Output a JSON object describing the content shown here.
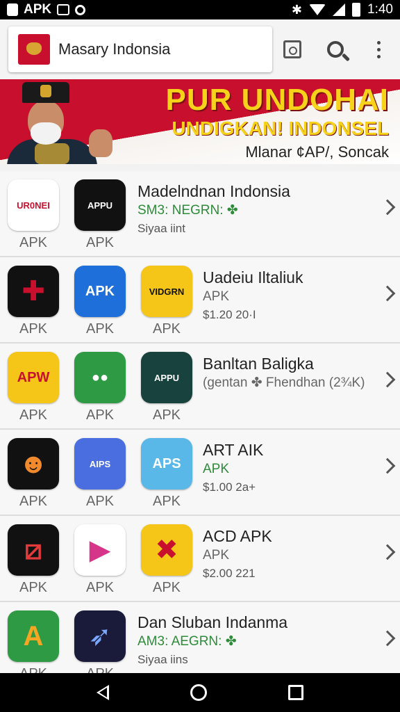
{
  "status_bar": {
    "left_label": "APK",
    "time": "1:40",
    "icons": [
      "android-icon",
      "apk-notify-icon",
      "sync-circle-icon",
      "bluetooth-icon",
      "wifi-icon",
      "signal-icon",
      "battery-icon"
    ]
  },
  "app_bar": {
    "search_title": "Masary Indonsia",
    "actions": [
      "calendar-icon",
      "search-icon",
      "more-vert-icon"
    ]
  },
  "banner": {
    "line1": "PUR UNDOHAI",
    "line2": "UNDIGKAN! INDONSEL",
    "line3": "Mlanar ¢AP/, Soncak"
  },
  "rows": [
    {
      "tiles": [
        {
          "glyph": "UR0NEI",
          "bg": "#ffffff",
          "fg": "#c8102e",
          "caption": "APK",
          "icon_name": "red-arrow-app-icon"
        },
        {
          "glyph": "APPU",
          "bg": "#111111",
          "fg": "#ffffff",
          "caption": "APK",
          "icon_name": "axe-app-icon"
        }
      ],
      "title": "Madelndnan Indonsia",
      "line2": "SM3: NEGRN: ✤",
      "line2_color": "green",
      "line3": "Siyaa iint"
    },
    {
      "tiles": [
        {
          "glyph": "✚",
          "bg": "#111111",
          "fg": "#c8102e",
          "caption": "APK",
          "icon_name": "compass-app-icon"
        },
        {
          "glyph": "APK",
          "bg": "#1e6fd9",
          "fg": "#ffffff",
          "caption": "APK",
          "icon_name": "blue-a-app-icon"
        },
        {
          "glyph": "VIDGRN",
          "bg": "#f5c518",
          "fg": "#111111",
          "caption": "APK",
          "icon_name": "yellow-ring-app-icon"
        }
      ],
      "title": "Uadeiu Iltaliuk",
      "line2": "APK",
      "line2_color": "gray",
      "line3": "$1.20 20·I"
    },
    {
      "tiles": [
        {
          "glyph": "APW",
          "bg": "#f5c518",
          "fg": "#c8102e",
          "caption": "APK",
          "icon_name": "apw-app-icon"
        },
        {
          "glyph": "●●",
          "bg": "#2e9a44",
          "fg": "#ffffff",
          "caption": "APK",
          "icon_name": "map-pin-app-icon"
        },
        {
          "glyph": "APPU",
          "bg": "#17423d",
          "fg": "#ffffff",
          "caption": "APK",
          "icon_name": "axe-green-app-icon"
        }
      ],
      "title": "Banltan Baligka",
      "line2": "(gentan ✤ Fhendhan (2¾K)",
      "line2_color": "gray",
      "line3": ""
    },
    {
      "tiles": [
        {
          "glyph": "☻",
          "bg": "#111111",
          "fg": "#f08a2c",
          "caption": "APK",
          "icon_name": "fox-app-icon"
        },
        {
          "glyph": "AIPS",
          "bg": "#4a6ee0",
          "fg": "#ffffff",
          "caption": "APK",
          "icon_name": "rocket-app-icon"
        },
        {
          "glyph": "APS",
          "bg": "#5ab8e8",
          "fg": "#ffffff",
          "caption": "APK",
          "icon_name": "swirl-app-icon"
        }
      ],
      "title": "ART AIK",
      "line2": "APK",
      "line2_color": "green",
      "line3": "$1.00 2a+"
    },
    {
      "tiles": [
        {
          "glyph": "⧄",
          "bg": "#111111",
          "fg": "#e23a3a",
          "caption": "APK",
          "icon_name": "square-x-app-icon"
        },
        {
          "glyph": "▶",
          "bg": "#ffffff",
          "fg": "#d6368a",
          "caption": "APK",
          "icon_name": "play-app-icon"
        },
        {
          "glyph": "✖",
          "bg": "#f5c518",
          "fg": "#c8102e",
          "caption": "APK",
          "icon_name": "red-x-app-icon"
        }
      ],
      "title": "ACD APK",
      "line2": "APK",
      "line2_color": "gray",
      "line3": "$2.00 221"
    },
    {
      "tiles": [
        {
          "glyph": "A",
          "bg": "#2e9a44",
          "fg": "#f5a623",
          "caption": "APK",
          "icon_name": "green-a-app-icon"
        },
        {
          "glyph": "➶",
          "bg": "#1a1a3a",
          "fg": "#7aa7ff",
          "caption": "APK",
          "icon_name": "arrow-app-icon"
        }
      ],
      "title": "Dan Sluban Indanma",
      "line2": "AM3: AEGRN: ✤",
      "line2_color": "green",
      "line3": "Siyaa iins"
    }
  ],
  "nav_bar": [
    "back-icon",
    "home-icon",
    "recents-icon"
  ]
}
